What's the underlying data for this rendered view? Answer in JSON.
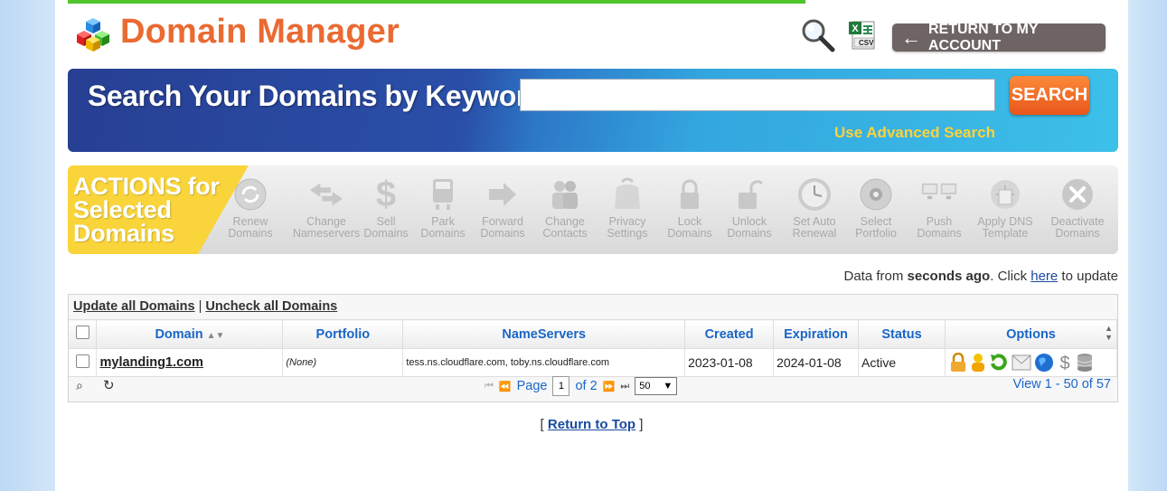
{
  "header": {
    "title": "Domain Manager",
    "return_label": "RETURN TO MY ACCOUNT",
    "csv_label": "CSV"
  },
  "search": {
    "heading": "Search Your Domains by Keyword",
    "button_label": "SEARCH",
    "advanced_link": "Use Advanced Search",
    "value": "",
    "placeholder": ""
  },
  "actions": {
    "heading_line1": "ACTIONS for",
    "heading_line2": "Selected",
    "heading_line3": "Domains",
    "items": [
      {
        "line1": "Renew",
        "line2": "Domains",
        "icon": "renew-icon"
      },
      {
        "line1": "Change",
        "line2": "Nameservers",
        "icon": "nameservers-icon"
      },
      {
        "line1": "Sell",
        "line2": "Domains",
        "icon": "dollar-icon"
      },
      {
        "line1": "Park",
        "line2": "Domains",
        "icon": "parking-icon"
      },
      {
        "line1": "Forward",
        "line2": "Domains",
        "icon": "forward-arrow-icon"
      },
      {
        "line1": "Change",
        "line2": "Contacts",
        "icon": "contacts-icon"
      },
      {
        "line1": "Privacy",
        "line2": "Settings",
        "icon": "privacy-bag-icon"
      },
      {
        "line1": "Lock",
        "line2": "Domains",
        "icon": "lock-icon"
      },
      {
        "line1": "Unlock",
        "line2": "Domains",
        "icon": "unlock-icon"
      },
      {
        "line1": "Set Auto",
        "line2": "Renewal",
        "icon": "clock-icon"
      },
      {
        "line1": "Select",
        "line2": "Portfolio",
        "icon": "portfolio-disc-icon"
      },
      {
        "line1": "Push",
        "line2": "Domains",
        "icon": "push-icon"
      },
      {
        "line1": "Apply DNS",
        "line2": "Template",
        "icon": "dns-template-icon"
      },
      {
        "line1": "Deactivate",
        "line2": "Domains",
        "icon": "deactivate-x-icon"
      }
    ]
  },
  "status_line": {
    "prefix": "Data from ",
    "bold": "seconds ago",
    "middle": ". Click ",
    "link": "here",
    "suffix": " to update"
  },
  "grid": {
    "update_all": "Update all Domains",
    "separator": " | ",
    "uncheck_all": "Uncheck all Domains",
    "columns": [
      "Domain",
      "Portfolio",
      "NameServers",
      "Created",
      "Expiration",
      "Status",
      "Options"
    ],
    "rows": [
      {
        "domain": "mylanding1.com",
        "portfolio": "(None)",
        "nameservers": "tess.ns.cloudflare.com, toby.ns.cloudflare.com",
        "created": "2023-01-08",
        "expiration": "2024-01-08",
        "status": "Active"
      }
    ],
    "pager": {
      "page_label": "Page",
      "page_value": "1",
      "of_label": "of 2",
      "per_page": "50",
      "view_info": "View 1 - 50 of 57"
    }
  },
  "footer": {
    "open_bracket": "[ ",
    "return_top": "Return to Top",
    "close_bracket": " ]"
  },
  "colors": {
    "title": "#ea6a32",
    "green_bar": "#4fc42d",
    "search_button": "#f26b26",
    "advanced_link": "#ffd23a",
    "actions_yellow": "#f9d43a",
    "grid_header_text": "#1a66c8"
  }
}
